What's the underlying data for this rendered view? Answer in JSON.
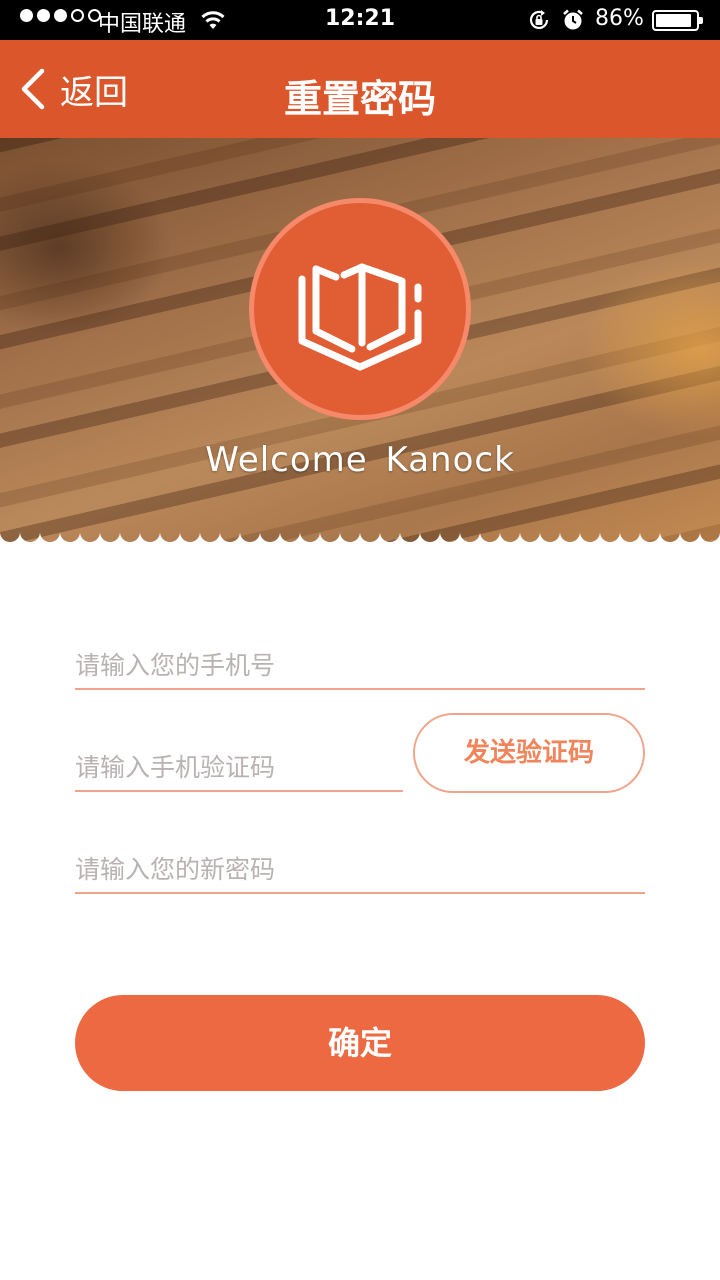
{
  "status_bar": {
    "carrier": "中国联通",
    "time": "12:21",
    "battery_percent": "86%",
    "battery_level": 0.86,
    "signal_bars_filled": 3,
    "signal_bars_total": 5,
    "icons": [
      "signal-dots-icon",
      "wifi-icon",
      "rotation-lock-icon",
      "alarm-icon",
      "battery-icon"
    ]
  },
  "nav": {
    "back_label": "返回",
    "title": "重置密码",
    "back_icon": "chevron-left-icon",
    "bar_color": "#dc562c"
  },
  "hero": {
    "logo_icon": "open-book-icon",
    "logo_color": "#e15e35",
    "welcome_text": "Welcome  Kanock"
  },
  "form": {
    "phone_placeholder": "请输入您的手机号",
    "phone_value": "",
    "code_placeholder": "请输入手机验证码",
    "code_value": "",
    "password_placeholder": "请输入您的新密码",
    "password_value": "",
    "send_code_label": "发送验证码",
    "confirm_label": "确定",
    "accent_color": "#ec6941"
  }
}
